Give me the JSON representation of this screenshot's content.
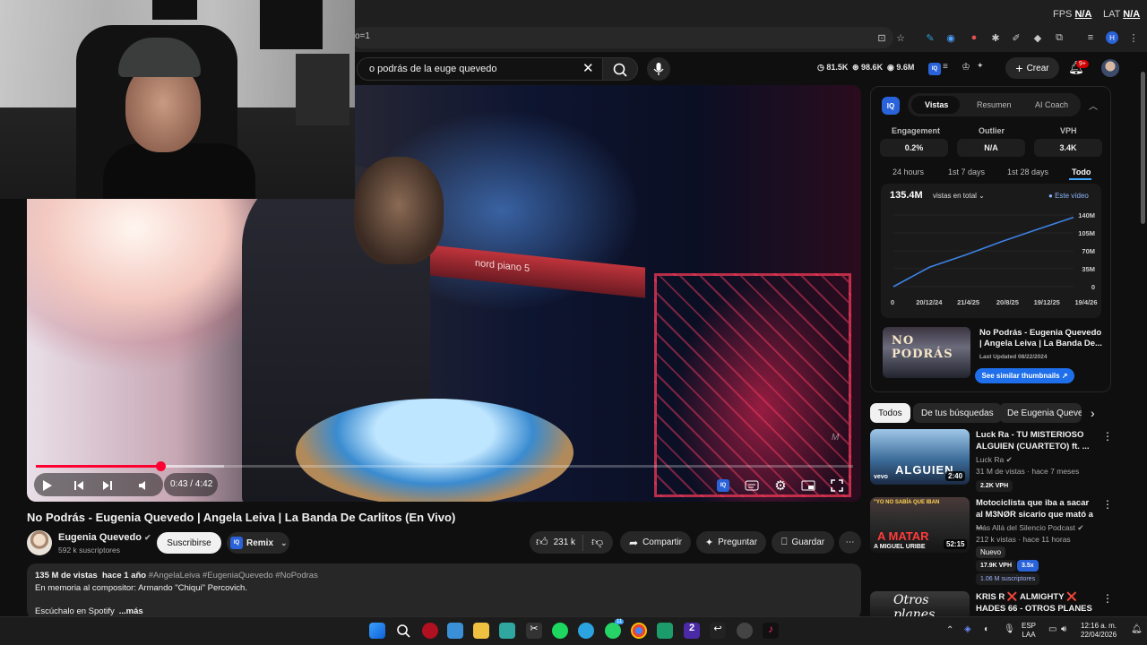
{
  "overlay": {
    "fps_label": "FPS",
    "fps_value": "N/A",
    "lat_label": "LAT",
    "lat_value": "N/A"
  },
  "browser": {
    "url_fragment": "o=1"
  },
  "header": {
    "search_query": "o podrás de la euge quevedo",
    "stats": {
      "likes_metric": "81.5K",
      "views_metric": "98.6K",
      "watch_metric": "9.6M"
    },
    "create_label": "Crear",
    "notifications_badge": "9+"
  },
  "player": {
    "current_time": "0:43",
    "duration": "4:42",
    "time_display": "0:43 / 4:42",
    "progress_fraction": 0.152,
    "buffered_fraction": 0.23,
    "stage_keyboard_label": "nord piano 5"
  },
  "video": {
    "title": "No Podrás - Eugenia Quevedo | Angela Leiva | La Banda De Carlitos (En Vivo)",
    "channel": "Eugenia Quevedo",
    "subscribers": "592 k suscriptores",
    "subscribe_label": "Suscribirse",
    "remix_label": "Remix",
    "likes": "231 k",
    "share_label": "Compartir",
    "ask_label": "Preguntar",
    "save_label": "Guardar"
  },
  "description": {
    "views": "135 M de vistas",
    "age": "hace 1 año",
    "hashtags": "#AngelaLeiva #EugeniaQuevedo #NoPodras",
    "line2": "En memoria al compositor: Armando \"Chiqui\" Percovich.",
    "line3": "Escúchalo en Spotify",
    "more_label": "...más"
  },
  "vidiq": {
    "logo": "IQ",
    "tabs": [
      "Vistas",
      "Resumen",
      "AI Coach"
    ],
    "metrics": [
      {
        "label": "Engagement",
        "value": "0.2%"
      },
      {
        "label": "Outlier",
        "value": "N/A"
      },
      {
        "label": "VPH",
        "value": "3.4K"
      }
    ],
    "ranges": [
      "24 hours",
      "1st 7 days",
      "1st 28 days",
      "Todo"
    ],
    "views_total": "135.4M",
    "views_mode": "vistas en total",
    "legend_label": "Este vídeo",
    "thumb_title": "No Podrás - Eugenia Quevedo | Angela Leiva | La Banda De...",
    "thumb_overlay": "NO PODRÁS",
    "last_updated": "Last Updated 08/22/2024",
    "similar_label": "See similar thumbnails"
  },
  "chart_data": {
    "type": "line",
    "x": [
      "0",
      "20/12/24",
      "21/4/25",
      "20/8/25",
      "19/12/25",
      "19/4/26"
    ],
    "series": [
      {
        "values": [
          0,
          38,
          62,
          88,
          112,
          135.4
        ]
      }
    ],
    "y_ticks": [
      "140M",
      "105M",
      "70M",
      "35M",
      "0"
    ],
    "ylim": [
      0,
      140
    ],
    "grid": true,
    "color": "#3e82e6"
  },
  "chips": [
    "Todos",
    "De tus búsquedas",
    "De Eugenia Quevedo"
  ],
  "recommended": [
    {
      "title": "Luck Ra - TU MISTERIOSO ALGUIEN (CUARTETO) ft. ...",
      "channel": "Luck Ra",
      "meta": "31 M de vistas · hace 7 meses",
      "duration": "2:40",
      "thumb_text": "ALGUIEN",
      "badge": "2.2K VPH"
    },
    {
      "title": "Motociclista que iba a sacar al M3NØR sicario que mató a ...",
      "channel": "Más Allá del Silencio Podcast",
      "meta": "212 k vistas · hace 11 horas",
      "duration": "52:15",
      "thumb_text": "A MATAR",
      "thumb_sub": "A MIGUEL URIBE",
      "thumb_top": "\"YO NO SABÍA QUE IBAN",
      "new_label": "Nuevo",
      "badge": "17.9K VPH",
      "badge2": "3.5x",
      "subs": "1.06 M suscriptores"
    },
    {
      "title": "KRIS R ❌ ALMIGHTY ❌ HADES 66 - OTROS PLANES ...",
      "thumb_text": "Otros planes"
    }
  ],
  "taskbar": {
    "lang": "ESP",
    "lang2": "LAA",
    "time": "12:16 a. m.",
    "date": "22/04/2026",
    "badge": "11"
  },
  "colors": {
    "accent_red": "#ff0033",
    "vidiq_blue": "#2a63d9",
    "link_blue": "#3ea6ff"
  }
}
